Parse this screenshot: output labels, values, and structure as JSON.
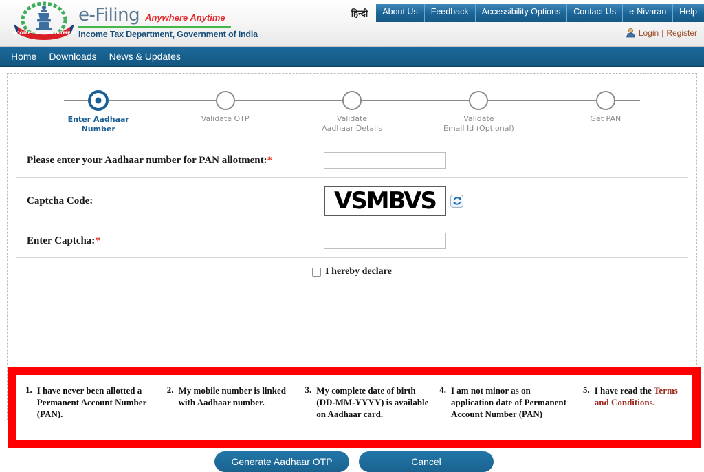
{
  "header": {
    "brand": {
      "emblem_icon": "india-emblem-income-tax-icon",
      "title": "e-Filing",
      "tagline": "Anywhere Anytime",
      "department": "Income Tax Department, Government of India"
    },
    "language_toggle": "हिन्दी",
    "nav_buttons": [
      {
        "label": "About Us"
      },
      {
        "label": "Feedback"
      },
      {
        "label": "Accessibility Options"
      },
      {
        "label": "Contact Us"
      },
      {
        "label": "e-Nivaran"
      },
      {
        "label": "Help"
      }
    ],
    "auth": {
      "avatar_icon": "user-avatar-icon",
      "login": "Login",
      "separator": "|",
      "register": "Register"
    }
  },
  "mainnav": {
    "items": [
      {
        "label": "Home"
      },
      {
        "label": "Downloads"
      },
      {
        "label": "News & Updates"
      }
    ]
  },
  "stepper": {
    "steps": [
      {
        "label": "Enter Aadhaar Number",
        "line1": "Enter Aadhaar",
        "line2": "Number",
        "active": true
      },
      {
        "label": "Validate OTP",
        "line1": "Validate OTP",
        "line2": "",
        "active": false
      },
      {
        "label": "Validate Aadhaar Details",
        "line1": "Validate",
        "line2": "Aadhaar Details",
        "active": false
      },
      {
        "label": "Validate Email Id (Optional)",
        "line1": "Validate",
        "line2": "Email Id (Optional)",
        "active": false
      },
      {
        "label": "Get PAN",
        "line1": "Get PAN",
        "line2": "",
        "active": false
      }
    ]
  },
  "form": {
    "aadhaar": {
      "label": "Please enter your Aadhaar number for PAN allotment:",
      "required_mark": "*",
      "value": "",
      "placeholder": ""
    },
    "captcha": {
      "label": "Captcha Code:",
      "code": "VSMBVS",
      "refresh_icon": "refresh-captcha-icon"
    },
    "enter_captcha": {
      "label": "Enter Captcha:",
      "required_mark": "*",
      "value": "",
      "placeholder": ""
    },
    "consent": {
      "text": "I hereby declare"
    }
  },
  "declarations": {
    "border_color": "#ff0000",
    "items": [
      {
        "num": "1.",
        "text": "I have never been allotted a Permanent Account Number (PAN)."
      },
      {
        "num": "2.",
        "text": "My mobile number is linked with Aadhaar number."
      },
      {
        "num": "3.",
        "text": "My complete date of birth (DD-MM-YYYY) is available on Aadhaar card."
      },
      {
        "num": "4.",
        "text": "I am not minor as on application date of Permanent Account Number (PAN)"
      },
      {
        "num": "5.",
        "text": "I have read the ",
        "link": "Terms and Conditions."
      }
    ]
  },
  "buttons": {
    "primary": "Generate Aadhaar OTP",
    "cancel": "Cancel"
  },
  "colors": {
    "nav_blue": "#14567f",
    "accent_blue": "#1a5f96",
    "alert_red": "#ff0000",
    "link_brown": "#9b4a23",
    "required_red": "#e03a1e"
  }
}
